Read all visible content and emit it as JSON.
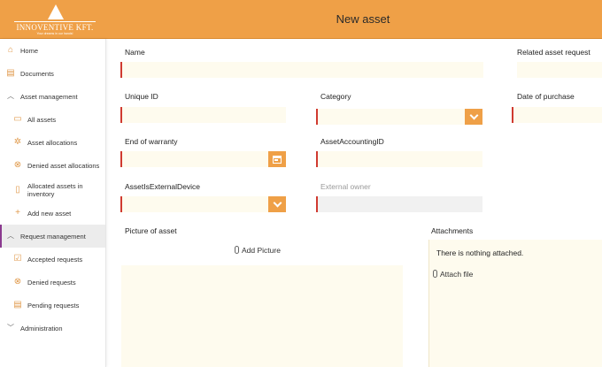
{
  "header": {
    "title": "New asset",
    "logo_text": "INNOVENTIVE KFT.",
    "logo_tagline": "Your dreams in our hands!",
    "accent_color": "#efa047"
  },
  "sidebar": {
    "items": [
      {
        "label": "Home",
        "icon": "home-icon"
      },
      {
        "label": "Documents",
        "icon": "document-icon"
      },
      {
        "label": "Asset management",
        "icon": "chevron-up-icon"
      },
      {
        "label": "All assets",
        "icon": "monitor-icon"
      },
      {
        "label": "Asset allocations",
        "icon": "gear-icon"
      },
      {
        "label": "Denied asset allocations",
        "icon": "circle-x-icon"
      },
      {
        "label": "Allocated assets in inventory",
        "icon": "clipboard-icon"
      },
      {
        "label": "Add new asset",
        "icon": "plus-icon"
      },
      {
        "label": "Request management",
        "icon": "chevron-up-icon"
      },
      {
        "label": "Accepted requests",
        "icon": "check-box-icon"
      },
      {
        "label": "Denied requests",
        "icon": "circle-x-icon"
      },
      {
        "label": "Pending requests",
        "icon": "document-icon"
      },
      {
        "label": "Administration",
        "icon": "chevron-down-icon"
      }
    ],
    "active": "Request management",
    "active_color": "#8b3a8f"
  },
  "form": {
    "name_label": "Name",
    "related_request_label": "Related asset request",
    "unique_id_label": "Unique ID",
    "category_label": "Category",
    "date_purchase_label": "Date of purchase",
    "end_warranty_label": "End of warranty",
    "accounting_id_label": "AssetAccountingID",
    "external_device_label": "AssetIsExternalDevice",
    "external_owner_label": "External owner",
    "picture_label": "Picture of asset",
    "add_picture": "Add Picture",
    "attachments_label": "Attachments",
    "nothing_attached": "There is nothing attached.",
    "attach_file": "Attach file"
  }
}
